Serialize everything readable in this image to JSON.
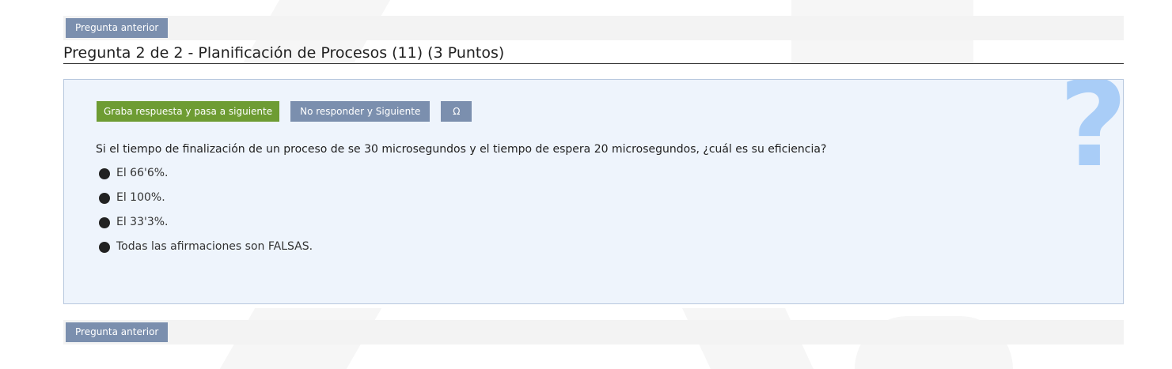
{
  "nav": {
    "prev_label": "Pregunta anterior"
  },
  "question": {
    "title": "Pregunta 2 de 2 - Planificación de Procesos (11) (3 Puntos)",
    "text": "Si el tiempo de finalización de un proceso de se 30 microsegundos y el tiempo de espera 20 microsegundos, ¿cuál es su eficiencia?",
    "options": [
      "El 66'6%.",
      "El 100%.",
      "El 33'3%.",
      "Todas las afirmaciones son FALSAS."
    ]
  },
  "actions": {
    "save_next_label": "Graba respuesta y pasa a siguiente",
    "skip_label": "No responder y Siguiente",
    "omega_label": "Ω"
  },
  "decor": {
    "help_icon_glyph": "?"
  },
  "colors": {
    "green": "#6e9c33",
    "slate": "#7b8fae",
    "panel_bg": "#eef4fc",
    "question_mark": "#a9cdf7"
  }
}
